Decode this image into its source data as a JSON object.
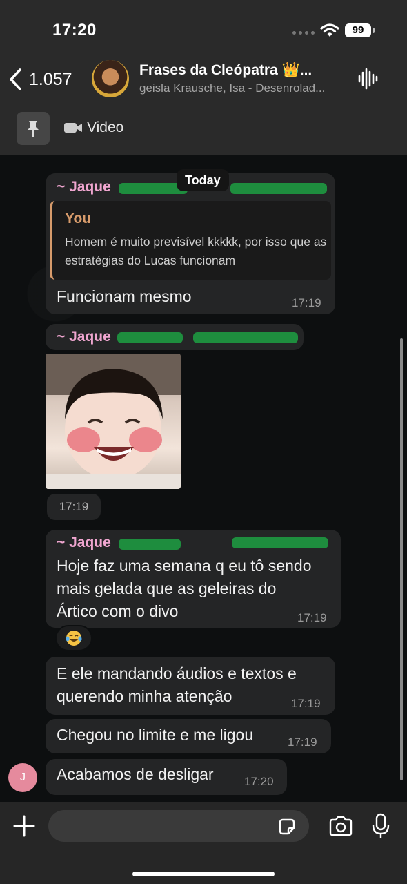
{
  "status": {
    "time": "17:20",
    "battery": "99"
  },
  "header": {
    "back_count": "1.057",
    "title": "Frases da Cleópatra 👑...",
    "subtitle": "geisla Krausche, Isa - Desenrolad...",
    "video_label": "Video"
  },
  "chat": {
    "date_divider": "Today",
    "messages": [
      {
        "sender": "~ Jaque",
        "quote_author": "You",
        "quote_text": "Homem é muito previsível kkkkk, por isso que as estratégias do Lucas funcionam",
        "text": "Funcionam mesmo",
        "time": "17:19"
      },
      {
        "sender": "~ Jaque",
        "image": "sticker-smiling-child",
        "time": "17:19"
      },
      {
        "sender": "~ Jaque",
        "text": "Hoje faz uma semana q eu tô sendo mais gelada que as geleiras do Ártico com o divo",
        "time": "17:19",
        "reaction": "😂"
      },
      {
        "text": "E ele mandando áudios e textos e querendo minha atenção",
        "time": "17:19"
      },
      {
        "text": "Chegou no limite e me ligou",
        "time": "17:19"
      },
      {
        "text": "Acabamos de desligar",
        "time": "17:20",
        "avatar_initial": "J"
      }
    ]
  },
  "colors": {
    "sender": "#f0a6d0",
    "quote_accent": "#d79b6b",
    "bubble": "#242526",
    "avatar": "#e58a9d"
  }
}
